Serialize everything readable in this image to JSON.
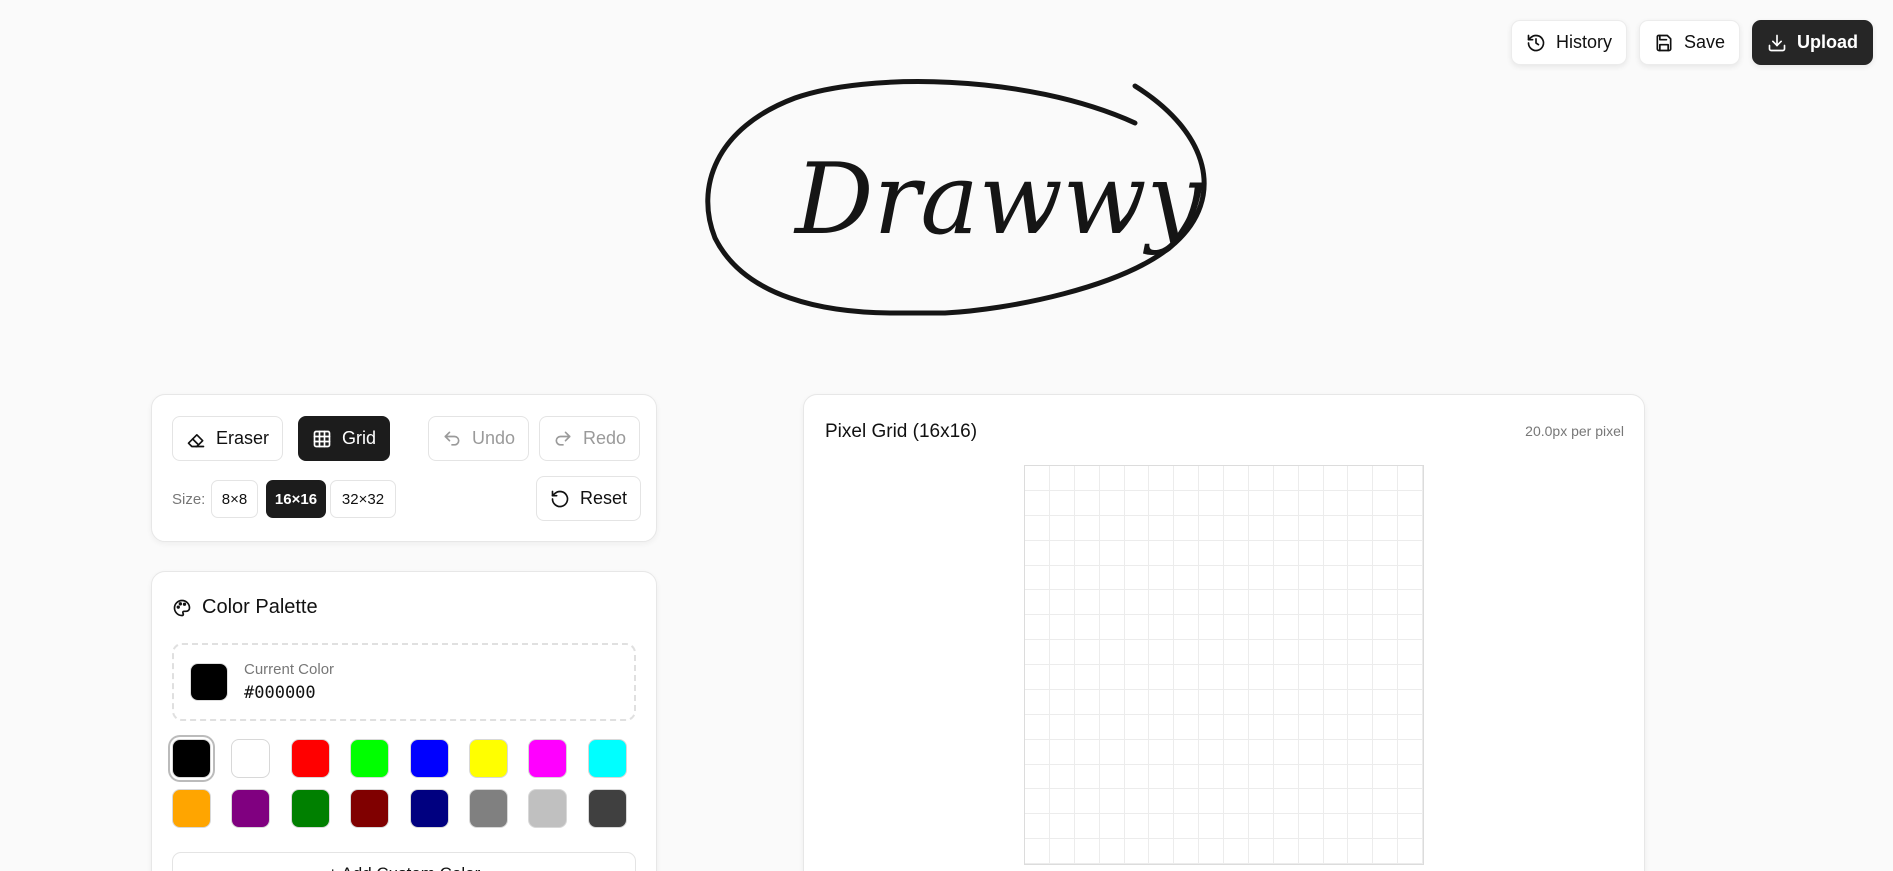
{
  "top_actions": {
    "history_label": "History",
    "save_label": "Save",
    "upload_label": "Upload"
  },
  "logo": {
    "text": "Drawwy"
  },
  "toolbar": {
    "eraser_label": "Eraser",
    "grid_label": "Grid",
    "undo_label": "Undo",
    "redo_label": "Redo",
    "size_label": "Size:",
    "sizes": [
      "8×8",
      "16×16",
      "32×32"
    ],
    "active_size": "16×16",
    "reset_label": "Reset"
  },
  "palette": {
    "title": "Color Palette",
    "current_label": "Current Color",
    "current_hex": "#000000",
    "colors": [
      "#000000",
      "#ffffff",
      "#ff0000",
      "#00ff00",
      "#0000ff",
      "#ffff00",
      "#ff00ff",
      "#00ffff",
      "#ffa500",
      "#800080",
      "#008000",
      "#800000",
      "#000080",
      "#808080",
      "#c0c0c0",
      "#404040"
    ],
    "add_label": "+ Add Custom Color"
  },
  "grid": {
    "title": "Pixel Grid (16x16)",
    "scale": "20.0px per pixel",
    "cells": 16
  }
}
